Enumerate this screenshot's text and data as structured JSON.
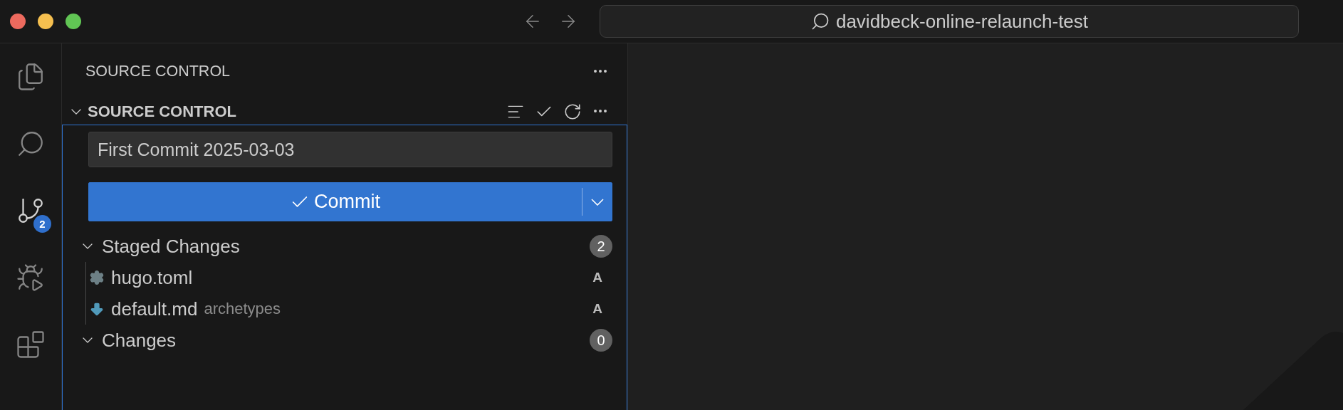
{
  "title_bar": {
    "search": "davidbeck-online-relaunch-test"
  },
  "activity_bar": [
    {
      "kind": "explorer",
      "selected": false
    },
    {
      "kind": "search",
      "selected": false
    },
    {
      "kind": "scm",
      "selected": true,
      "badge": "2"
    },
    {
      "kind": "debug",
      "selected": false
    },
    {
      "kind": "extensions",
      "selected": false
    }
  ],
  "sidebar": {
    "title": "SOURCE CONTROL",
    "section": {
      "title": "SOURCE CONTROL",
      "expanded": true
    },
    "commit_message": "First Commit 2025-03-03",
    "commit_button": "Commit",
    "groups": [
      {
        "label": "Staged Changes",
        "count": "2",
        "expanded": true,
        "files": [
          {
            "name": "hugo.toml",
            "kind": "settings",
            "status": "A"
          },
          {
            "name": "default.md",
            "folder": "archetypes",
            "kind": "download",
            "status": "A"
          }
        ]
      },
      {
        "label": "Changes",
        "count": "0",
        "expanded": true
      }
    ]
  }
}
